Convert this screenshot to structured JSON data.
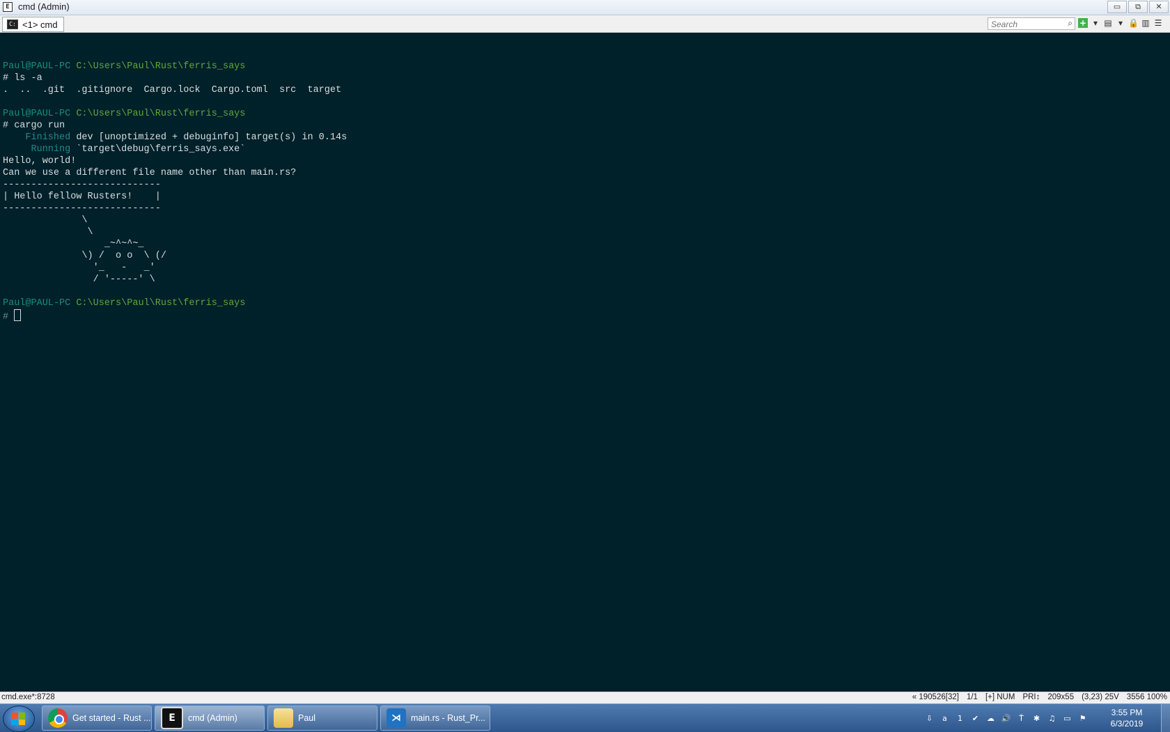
{
  "window": {
    "title": "cmd (Admin)",
    "icon": "conemu-icon",
    "buttons": {
      "minimize": "▭",
      "restore": "⧉",
      "close": "✕"
    }
  },
  "tabbar": {
    "tab_label": "<1> cmd",
    "search_placeholder": "Search",
    "tools": [
      "+",
      "▾",
      "▤",
      "▾",
      "🔒",
      "▥",
      "☰"
    ]
  },
  "console": {
    "lines": [
      {
        "segments": []
      },
      {
        "segments": [
          {
            "text": "Paul@PAUL-PC ",
            "cls": "user"
          },
          {
            "text": "C:\\Users\\Paul\\Rust\\ferris_says",
            "cls": "path"
          }
        ]
      },
      {
        "segments": [
          {
            "text": "# ls -a",
            "cls": "prompt"
          }
        ]
      },
      {
        "segments": [
          {
            "text": ".  ..  .git  .gitignore  Cargo.lock  Cargo.toml  src  target",
            "cls": "prompt"
          }
        ]
      },
      {
        "segments": []
      },
      {
        "segments": [
          {
            "text": "Paul@PAUL-PC ",
            "cls": "user"
          },
          {
            "text": "C:\\Users\\Paul\\Rust\\ferris_says",
            "cls": "path"
          }
        ]
      },
      {
        "segments": [
          {
            "text": "# cargo run",
            "cls": "prompt"
          }
        ]
      },
      {
        "segments": [
          {
            "text": "    Finished",
            "cls": "cargo"
          },
          {
            "text": " dev [unoptimized + debuginfo] target(s) in 0.14s",
            "cls": "prompt"
          }
        ]
      },
      {
        "segments": [
          {
            "text": "     Running",
            "cls": "cargo"
          },
          {
            "text": " `target\\debug\\ferris_says.exe`",
            "cls": "prompt"
          }
        ]
      },
      {
        "segments": [
          {
            "text": "Hello, world!",
            "cls": "prompt"
          }
        ]
      },
      {
        "segments": [
          {
            "text": "Can we use a different file name other than main.rs?",
            "cls": "prompt"
          }
        ]
      },
      {
        "segments": [
          {
            "text": "----------------------------",
            "cls": "prompt"
          }
        ]
      },
      {
        "segments": [
          {
            "text": "| Hello fellow Rusters!    |",
            "cls": "prompt"
          }
        ]
      },
      {
        "segments": [
          {
            "text": "----------------------------",
            "cls": "prompt"
          }
        ]
      },
      {
        "segments": [
          {
            "text": "              \\",
            "cls": "prompt"
          }
        ]
      },
      {
        "segments": [
          {
            "text": "               \\",
            "cls": "prompt"
          }
        ]
      },
      {
        "segments": [
          {
            "text": "                  _~^~^~_",
            "cls": "prompt"
          }
        ]
      },
      {
        "segments": [
          {
            "text": "              \\) /  o o  \\ (/",
            "cls": "prompt"
          }
        ]
      },
      {
        "segments": [
          {
            "text": "                '_   -   _'",
            "cls": "prompt"
          }
        ]
      },
      {
        "segments": [
          {
            "text": "                / '-----' \\",
            "cls": "prompt"
          }
        ]
      },
      {
        "segments": []
      },
      {
        "segments": [
          {
            "text": "Paul@PAUL-PC ",
            "cls": "user"
          },
          {
            "text": "C:\\Users\\Paul\\Rust\\ferris_says",
            "cls": "path"
          }
        ]
      },
      {
        "segments": [
          {
            "text": "# ",
            "cls": "dimprompt"
          }
        ],
        "cursor": true
      }
    ]
  },
  "statusbar": {
    "left": "cmd.exe*:8728",
    "right": [
      "« 190526[32]",
      "1/1",
      "[+] NUM",
      "PRI↕",
      "209x55",
      "(3,23) 25V",
      "3556  100%"
    ]
  },
  "taskbar": {
    "start_icon": "windows-start-icon",
    "items": [
      {
        "label": "Get started - Rust ...",
        "icon": "chrome-icon"
      },
      {
        "label": "cmd (Admin)",
        "icon": "cmd-icon"
      },
      {
        "label": "Paul",
        "icon": "folder-icon"
      },
      {
        "label": "main.rs - Rust_Pr...",
        "icon": "vscode-icon"
      }
    ],
    "tray": [
      "⇩",
      "a",
      "1",
      "✔",
      "☁",
      "🔊",
      "Ť",
      "✱",
      "♫",
      "▭",
      "⚑"
    ],
    "clock_time": "3:55 PM",
    "clock_date": "6/3/2019"
  }
}
